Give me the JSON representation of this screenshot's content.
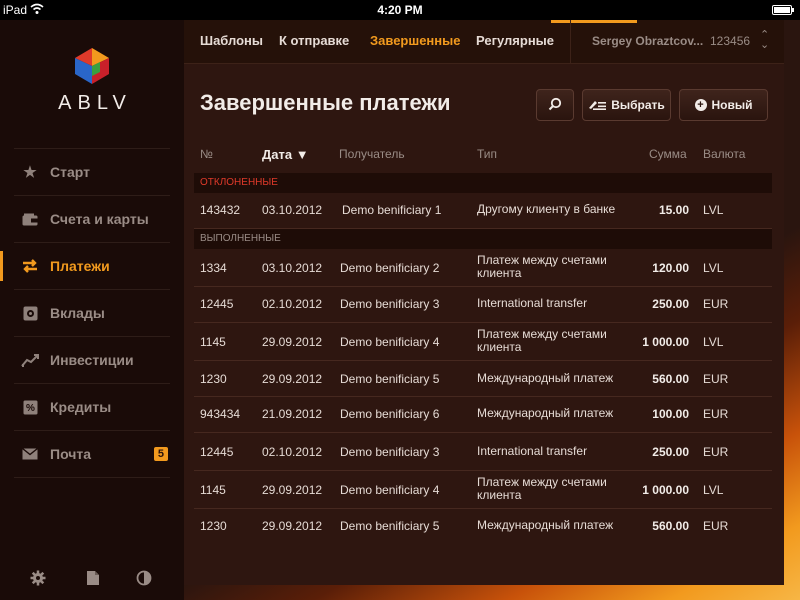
{
  "status": {
    "device": "iPad",
    "time": "4:20 PM"
  },
  "app": {
    "logo_text": "ABLV"
  },
  "sidebar": {
    "items": [
      {
        "label": "Старт",
        "icon": "star-icon",
        "active": false
      },
      {
        "label": "Счета и карты",
        "icon": "wallet-icon",
        "active": false
      },
      {
        "label": "Платежи",
        "icon": "transfer-arrows-icon",
        "active": true
      },
      {
        "label": "Вклады",
        "icon": "safe-icon",
        "active": false
      },
      {
        "label": "Инвестиции",
        "icon": "chart-icon",
        "active": false
      },
      {
        "label": "Кредиты",
        "icon": "percent-icon",
        "active": false
      },
      {
        "label": "Почта",
        "icon": "mail-icon",
        "active": false,
        "badge": "5"
      }
    ],
    "bottom_icons": [
      "settings-icon",
      "document-icon",
      "contrast-icon"
    ]
  },
  "topnav": {
    "tabs": [
      {
        "label": "Шаблоны",
        "active": false
      },
      {
        "label": "К отправке",
        "active": false
      },
      {
        "label": "Завершенные",
        "active": true
      },
      {
        "label": "Регулярные",
        "active": false
      }
    ],
    "user_name": "Sergey Obraztcov...",
    "user_number": "123456"
  },
  "page": {
    "title": "Завершенные платежи",
    "select_label": "Выбрать",
    "new_label": "Новый"
  },
  "table": {
    "columns": {
      "num": "№",
      "date": "Дата ▼",
      "recipient": "Получатель",
      "type": "Тип",
      "amount": "Сумма",
      "currency": "Валюта"
    },
    "groups": [
      {
        "title": "ОТКЛОНЕННЫЕ",
        "rows": [
          {
            "num": "143432",
            "date": "03.10.2012",
            "recipient": "Demo benificiary 1",
            "type": "Другому клиенту в банке",
            "amount": "15.00",
            "currency": "LVL"
          }
        ]
      },
      {
        "title": "ВЫПОЛНЕННЫЕ",
        "rows": [
          {
            "num": "1334",
            "date": "03.10.2012",
            "recipient": "Demo benificiary 2",
            "type": "Платеж между счетами клиента",
            "amount": "120.00",
            "currency": "LVL"
          },
          {
            "num": "12445",
            "date": "02.10.2012",
            "recipient": "Demo benificiary 3",
            "type": "International transfer",
            "amount": "250.00",
            "currency": "EUR"
          },
          {
            "num": "1145",
            "date": "29.09.2012",
            "recipient": "Demo benificiary 4",
            "type": "Платеж между счетами клиента",
            "amount": "1 000.00",
            "currency": "LVL"
          },
          {
            "num": "1230",
            "date": "29.09.2012",
            "recipient": "Demo benificiary 5",
            "type": "Международный платеж",
            "amount": "560.00",
            "currency": "EUR"
          },
          {
            "num": "943434",
            "date": "21.09.2012",
            "recipient": "Demo benificiary 6",
            "type": "Международный платеж",
            "amount": "100.00",
            "currency": "EUR"
          },
          {
            "num": "12445",
            "date": "02.10.2012",
            "recipient": "Demo benificiary 3",
            "type": "International transfer",
            "amount": "250.00",
            "currency": "EUR"
          },
          {
            "num": "1145",
            "date": "29.09.2012",
            "recipient": "Demo benificiary 4",
            "type": "Платеж между счетами клиента",
            "amount": "1 000.00",
            "currency": "LVL"
          },
          {
            "num": "1230",
            "date": "29.09.2012",
            "recipient": "Demo benificiary 5",
            "type": "Международный платеж",
            "amount": "560.00",
            "currency": "EUR"
          }
        ]
      }
    ]
  },
  "colors": {
    "accent": "#f29a1e",
    "rejected": "#e03a2a",
    "panel": "#2e1610",
    "sidebar": "#1a0b08"
  }
}
